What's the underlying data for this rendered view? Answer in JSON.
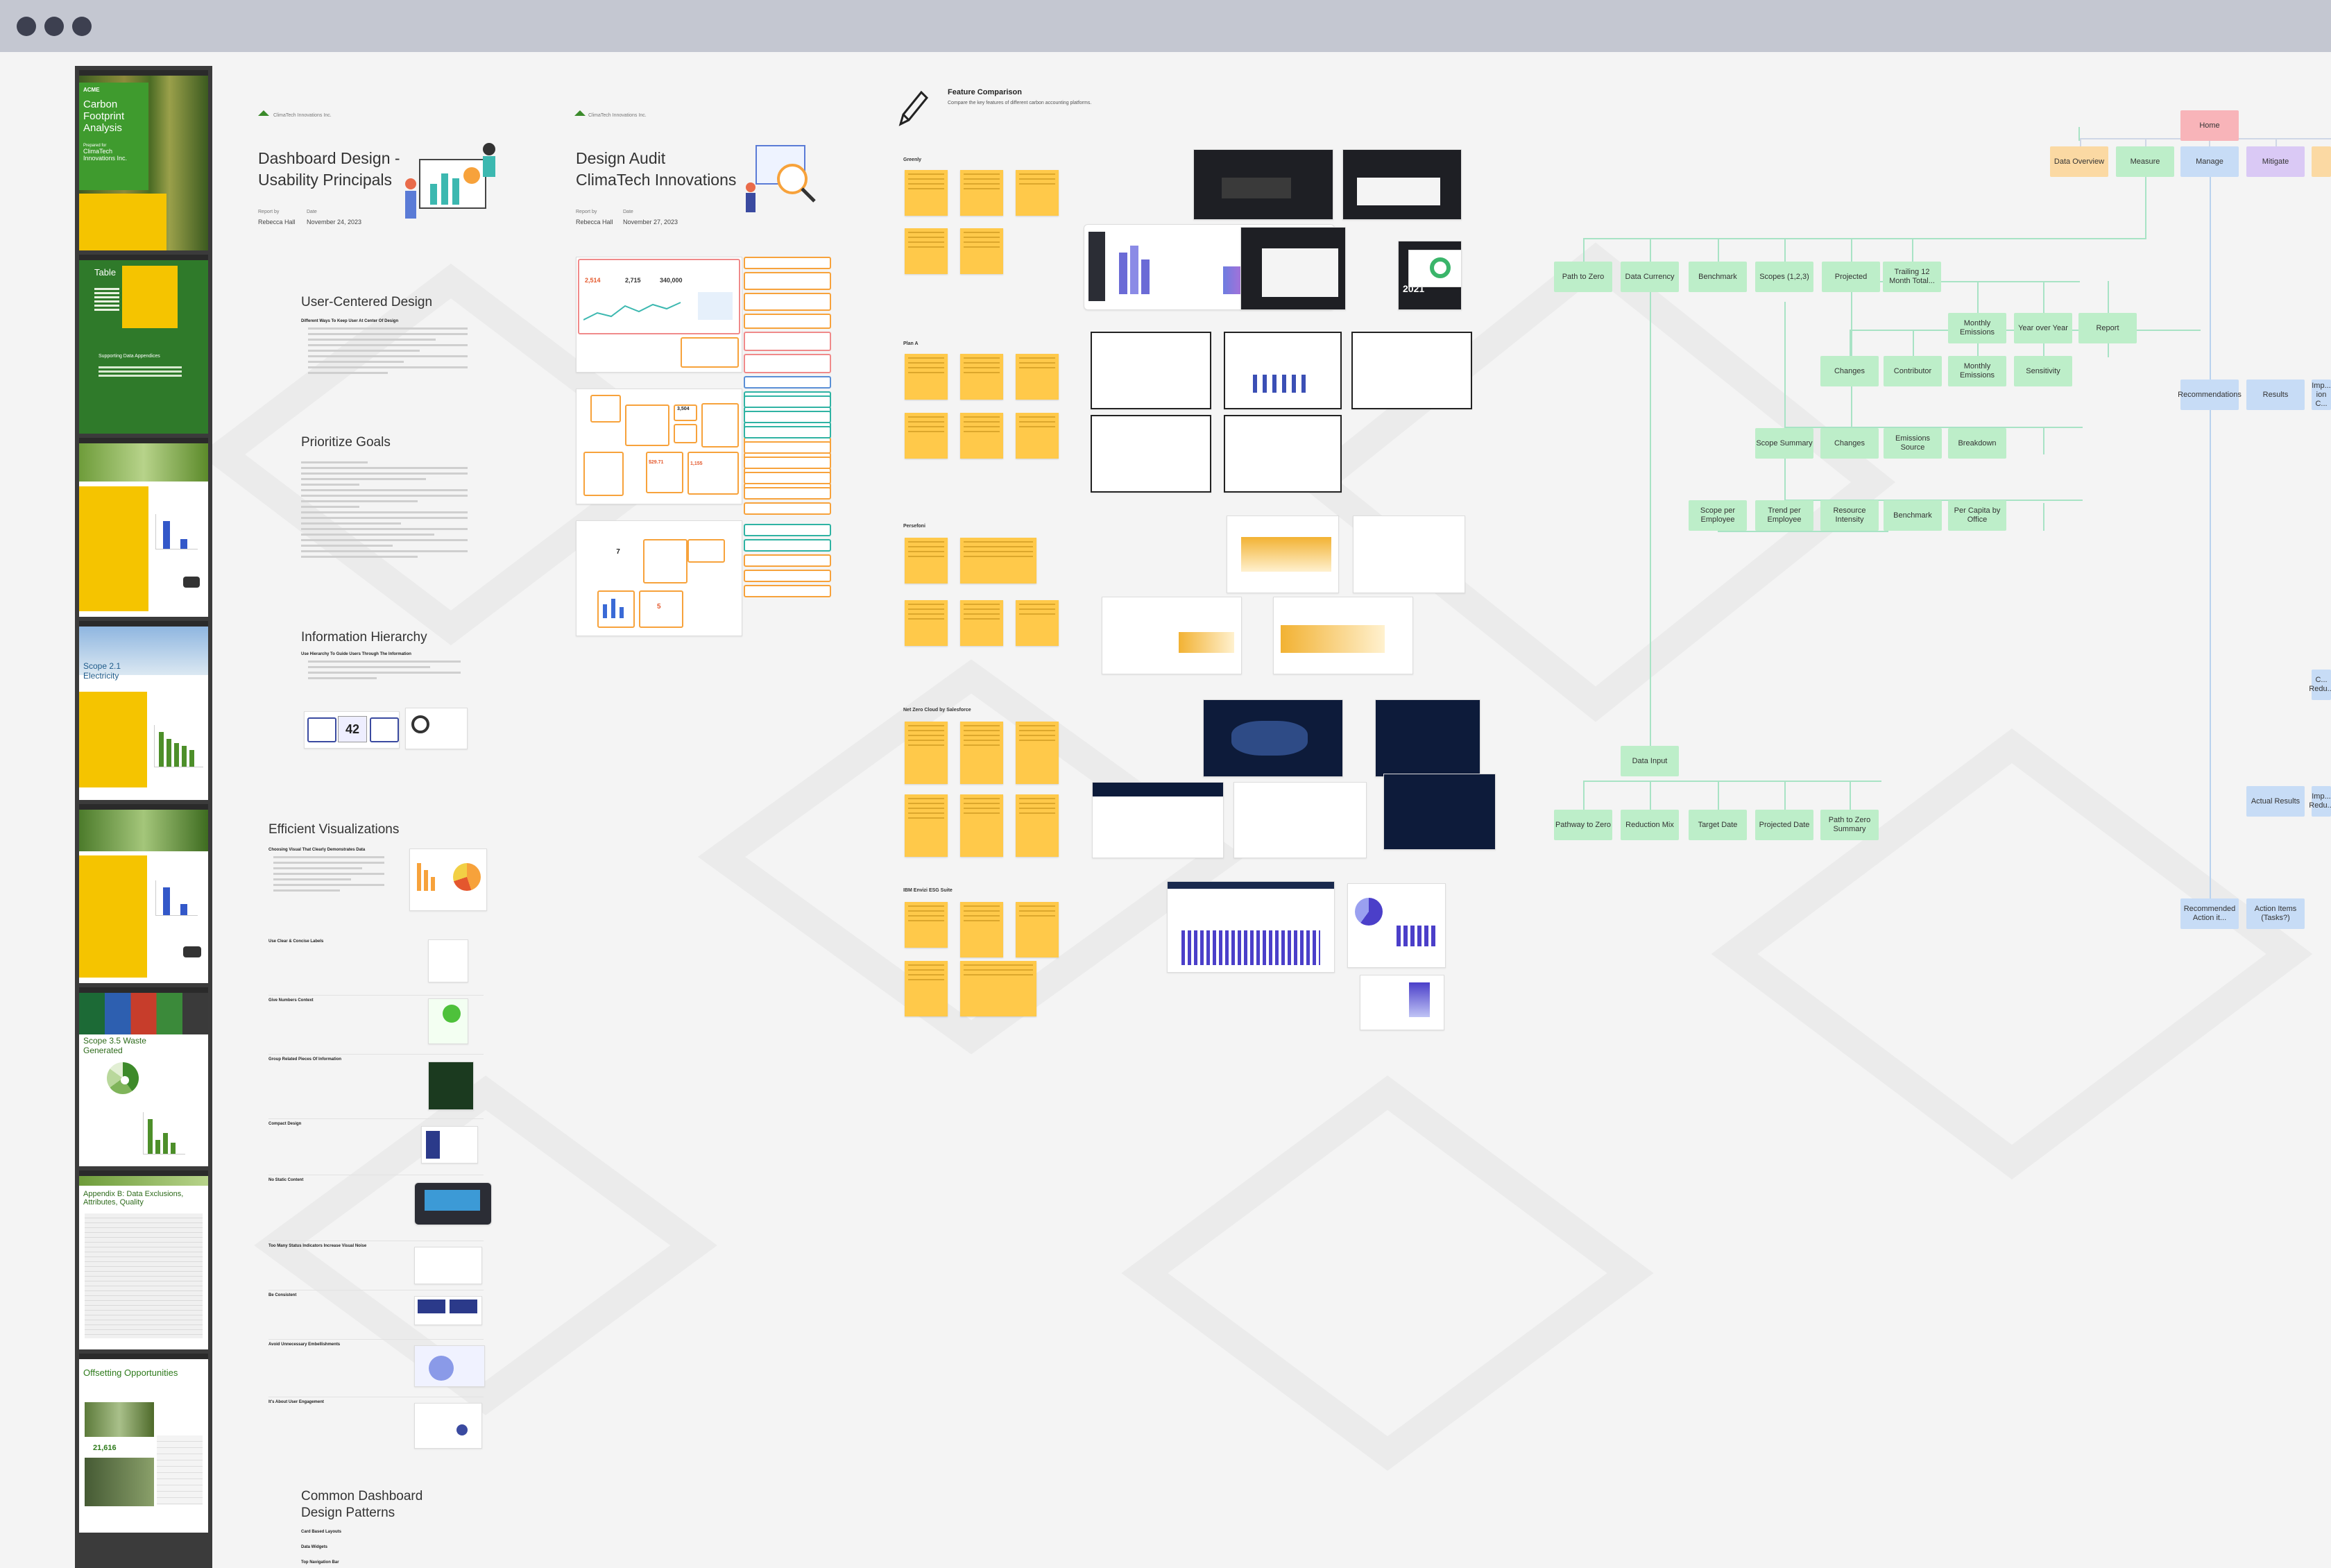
{
  "slides": {
    "s1": {
      "brand": "ACME",
      "title": "Carbon Footprint Analysis",
      "prepared_label": "Prepared for",
      "company": "ClimaTech Innovations Inc."
    },
    "s2": {
      "title": "Table",
      "supporting": "Supporting Data Appendices"
    },
    "s5": {
      "title": "Scope 2.1 Electricity"
    },
    "s7": {
      "title": "Scope 3.5 Waste Generated"
    },
    "s8": {
      "title": "Appendix B: Data Exclusions, Attributes, Quality"
    },
    "s9": {
      "title": "Offsetting Opportunities",
      "stat": "21,616"
    }
  },
  "doc1": {
    "company": "ClimaTech Innovations Inc.",
    "title_line1": "Dashboard Design -",
    "title_line2": "Usability Principals",
    "report_by_label": "Report by",
    "date_label": "Date",
    "author": "Rebecca Hall",
    "date": "November 24, 2023",
    "sections": [
      "User-Centered Design",
      "Prioritize Goals",
      "Information Hierarchy",
      "Efficient Visualizations",
      "Common Dashboard Design Patterns"
    ],
    "ucd_sub": "Different Ways To Keep User At Center Of Design",
    "ih_sub": "Use Hierarchy To Guide Users Through The Information",
    "ev_sub": "Choosing Visual That Clearly Demonstrates Data",
    "ih_number": "42",
    "patterns": [
      "Card Based Layouts",
      "Data Widgets",
      "Top Navigation Bar"
    ],
    "ev_items": [
      "Use Clear & Concise Labels",
      "Give Numbers Context",
      "Group Related Pieces Of Information",
      "Compact Design",
      "No Static Content",
      "Too Many Status Indicators Increase Visual Noise",
      "Be Consistent",
      "Avoid Unnecessary Embellishments",
      "It's About User Engagement"
    ]
  },
  "doc2": {
    "company": "ClimaTech Innovations Inc.",
    "title_line1": "Design Audit",
    "title_line2": "ClimaTech Innovations",
    "report_by_label": "Report by",
    "date_label": "Date",
    "author": "Rebecca Hall",
    "date": "November 27, 2023",
    "metrics": [
      "2,514",
      "2,715",
      "340,000",
      "3,504",
      "$29.71",
      "1,155",
      "7",
      "5"
    ]
  },
  "feature": {
    "title": "Feature Comparison",
    "subtitle": "Compare the key features of different carbon accounting platforms.",
    "sections": [
      "Greenly",
      "Plan A",
      "Persefoni",
      "Net Zero Cloud by Salesforce",
      "IBM Envizi ESG Suite"
    ],
    "badge_year": "2021"
  },
  "sitemap": {
    "home": "Home",
    "top": [
      "Data Overview",
      "Measure",
      "Manage",
      "Mitigate"
    ],
    "measure_children": [
      "Path to Zero",
      "Data Currency",
      "Benchmark",
      "Scopes (1,2,3)",
      "Projected",
      "Trailing 12 Month Total..."
    ],
    "projected_children": [
      "Monthly Emissions",
      "Year over Year",
      "Report"
    ],
    "scope_row": [
      "Changes",
      "Contributor",
      "Monthly Emissions",
      "Sensitivity"
    ],
    "scope_row2": [
      "Scope Summary",
      "Changes",
      "Emissions Source",
      "Breakdown"
    ],
    "scope_row3": [
      "Scope per Employee",
      "Trend per Employee",
      "Resource Intensity",
      "Benchmark",
      "Per Capita by Office"
    ],
    "data_input": "Data Input",
    "data_input_children": [
      "Pathway to Zero",
      "Reduction Mix",
      "Target Date",
      "Projected Date",
      "Path to Zero Summary"
    ],
    "manage_children": [
      "Recommendations",
      "Results",
      "Imp... ion C..."
    ],
    "manage_lower": [
      "Actual Results",
      "Imp... Redu..."
    ],
    "manage_bottom": [
      "Recommended Action it...",
      "Action Items (Tasks?)"
    ],
    "right_cut": [
      "C... Redu..."
    ]
  }
}
